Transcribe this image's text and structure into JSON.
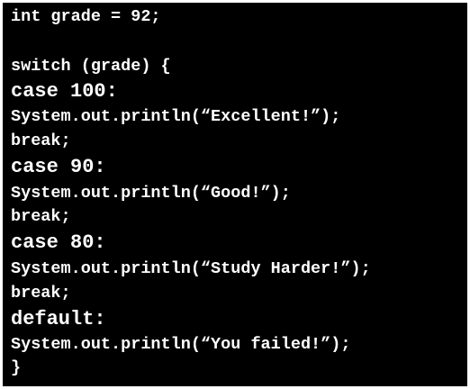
{
  "code": {
    "lines": [
      "int grade = 92;",
      "",
      "switch (grade) {",
      "case 100:",
      "System.out.println(“Excellent!”);",
      "break;",
      "case 90:",
      "System.out.println(“Good!”);",
      "break;",
      "case 80:",
      "System.out.println(“Study Harder!”);",
      "break;",
      "default:",
      "System.out.println(“You failed!”);",
      "}"
    ]
  },
  "colors": {
    "background": "#000000",
    "text": "#ffffff",
    "border": "#ffffff"
  }
}
